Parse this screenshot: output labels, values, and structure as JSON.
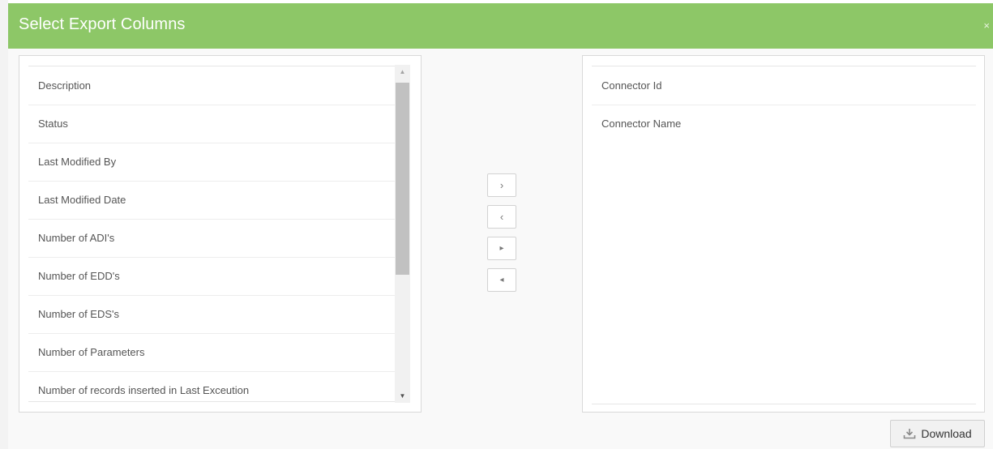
{
  "dialog": {
    "title": "Select Export Columns",
    "close_glyph": "×"
  },
  "available_columns": {
    "items": [
      "Description",
      "Status",
      "Last Modified By",
      "Last Modified Date",
      "Number of ADI's",
      "Number of EDD's",
      "Number of EDS's",
      "Number of Parameters",
      "Number of records inserted in Last Exceution"
    ]
  },
  "selected_columns": {
    "items": [
      "Connector Id",
      "Connector Name"
    ]
  },
  "transfer_buttons": {
    "move_selected_right": "›",
    "move_selected_left": "‹",
    "move_all_right": "▸",
    "move_all_left": "◂"
  },
  "footer": {
    "download_label": "Download"
  },
  "colors": {
    "header_bg": "#8dc767",
    "header_text": "#ffffff"
  }
}
